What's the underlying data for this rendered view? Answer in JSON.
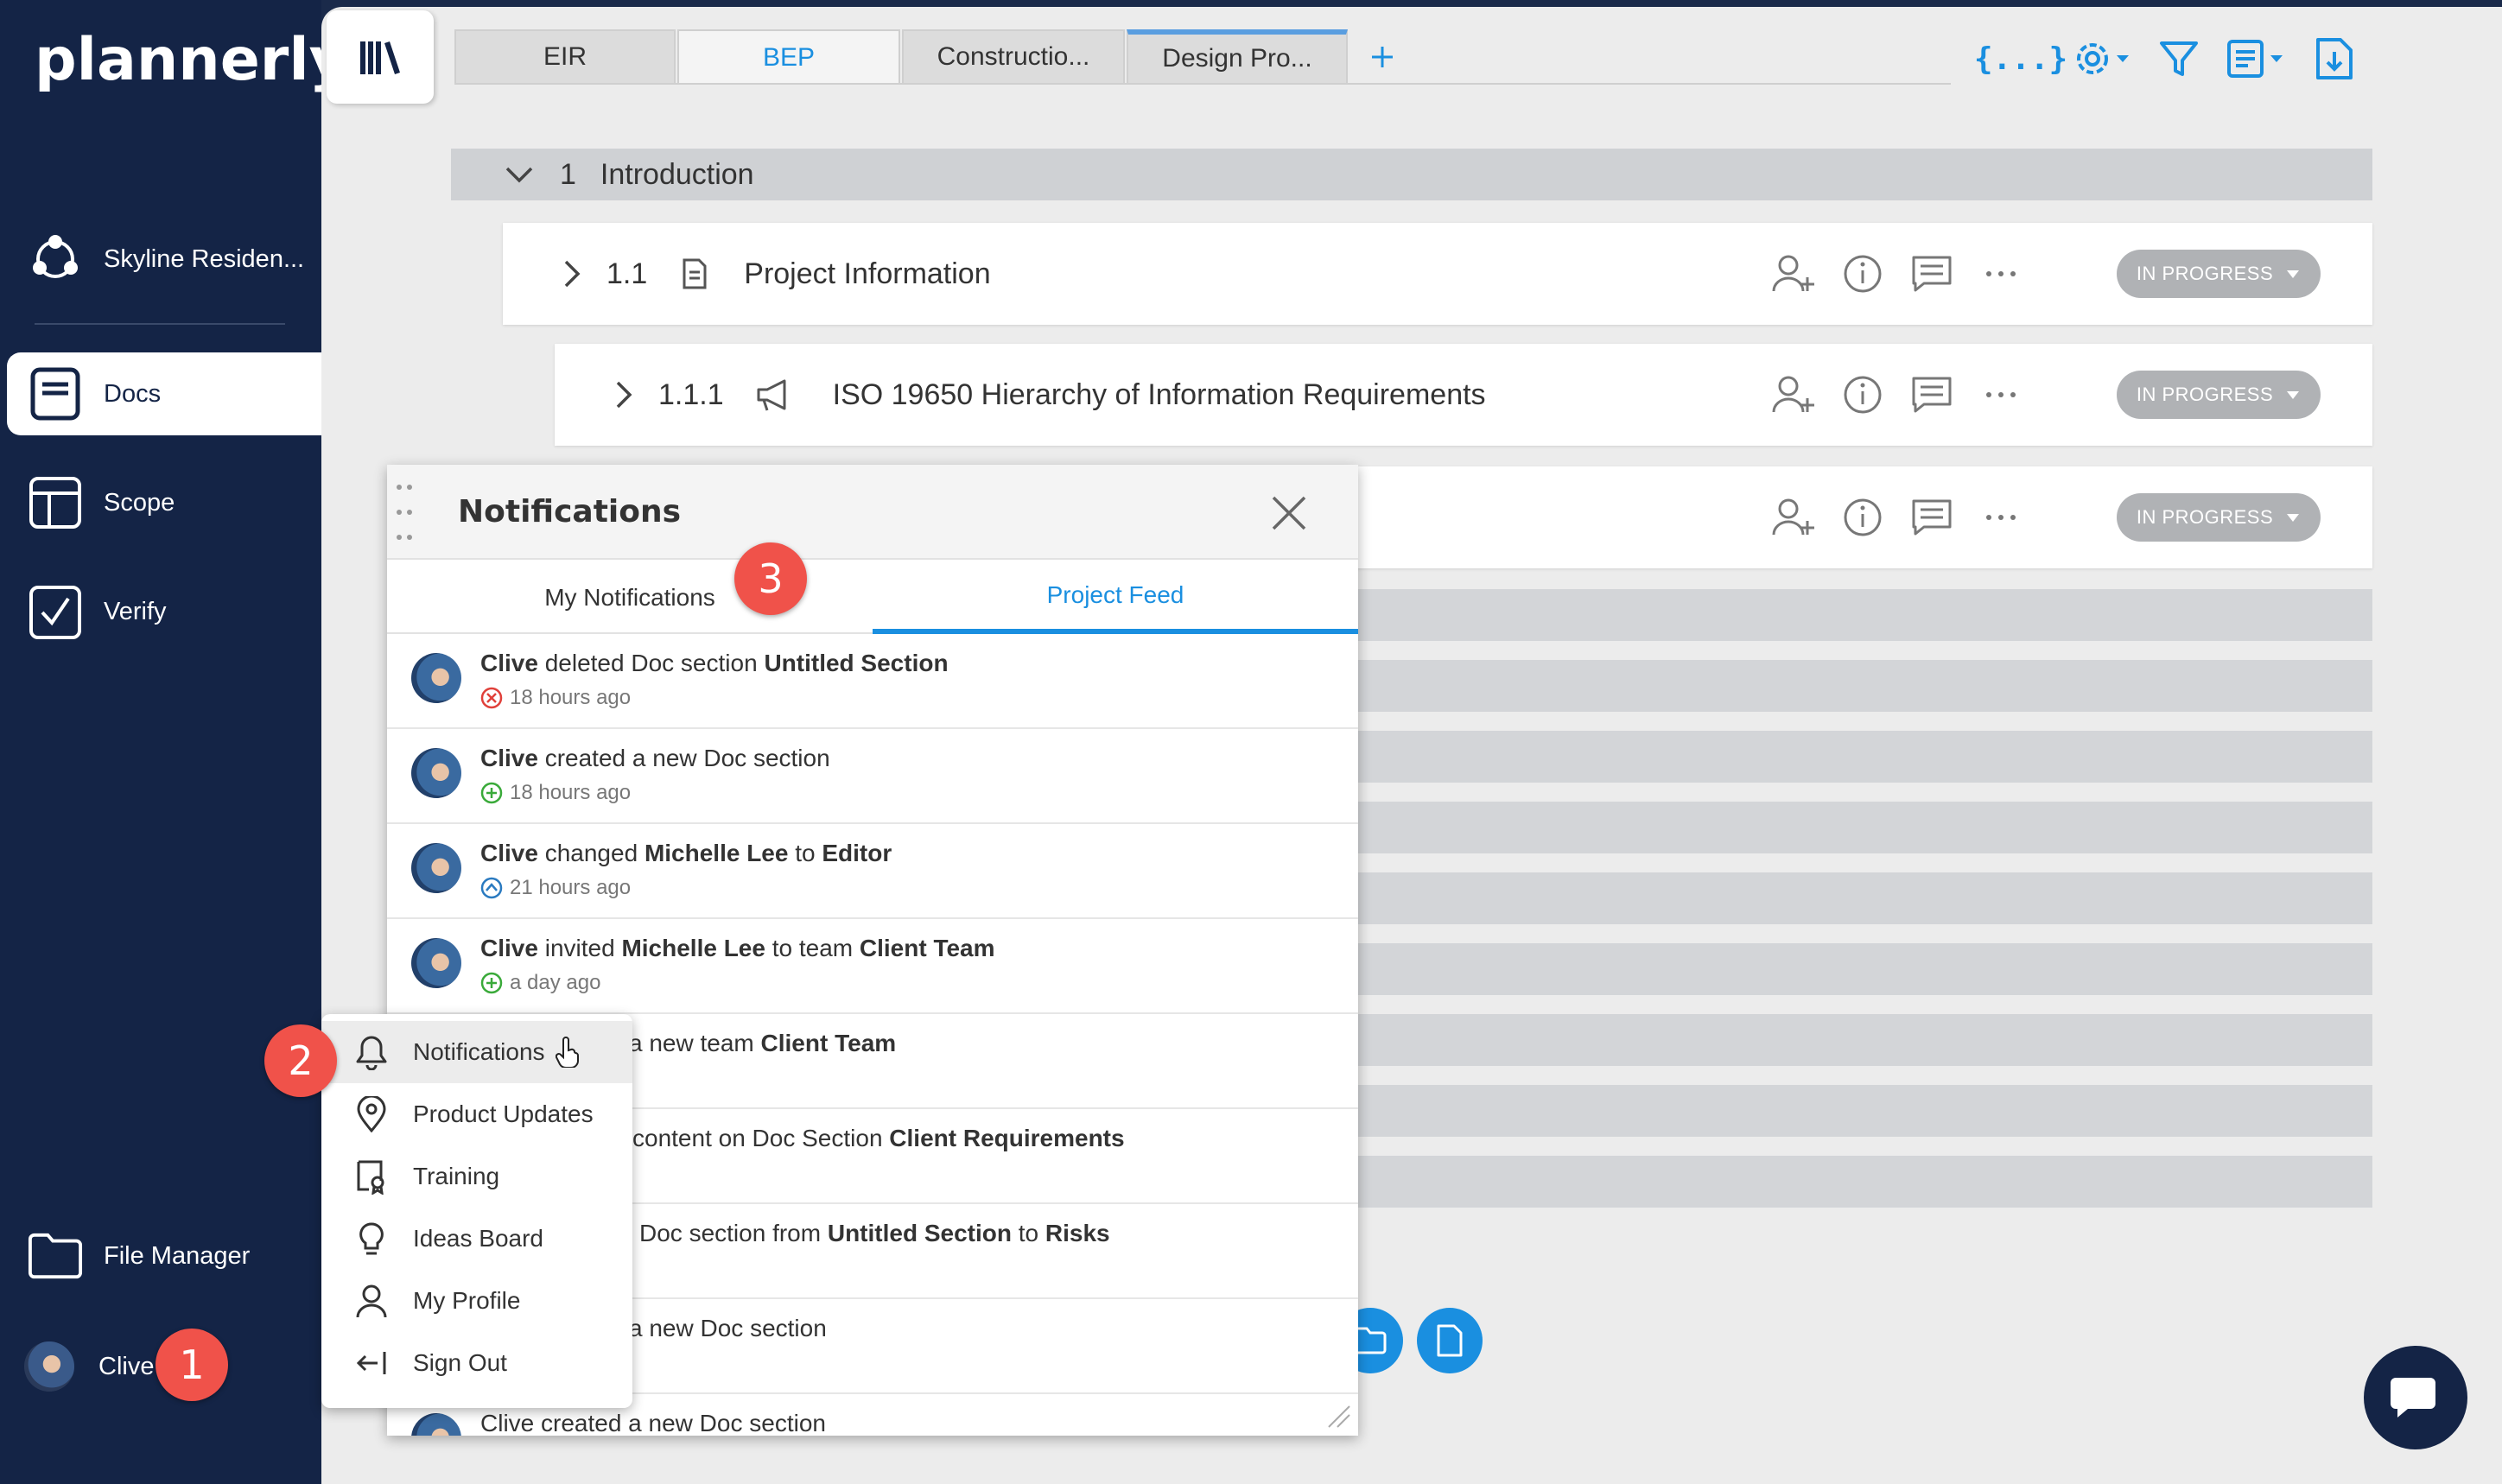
{
  "app": {
    "logo": "plannerly"
  },
  "sidebar": {
    "project": "Skyline Residen...",
    "items": [
      {
        "label": "Docs"
      },
      {
        "label": "Scope"
      },
      {
        "label": "Verify"
      }
    ],
    "file_manager": "File Manager",
    "user": "Clive"
  },
  "tabs": [
    {
      "label": "EIR"
    },
    {
      "label": "BEP"
    },
    {
      "label": "Constructio..."
    },
    {
      "label": "Design Pro..."
    }
  ],
  "toolbar": {
    "add_tab": "+",
    "variables": "{...}"
  },
  "sections": {
    "s1": {
      "number": "1",
      "title": "Introduction"
    },
    "s11": {
      "number": "1.1",
      "title": "Project Information",
      "status": "IN PROGRESS"
    },
    "s111": {
      "number": "1.1.1",
      "title": "ISO 19650 Hierarchy of Information Requirements",
      "status": "IN PROGRESS"
    },
    "s3": {
      "status": "IN PROGRESS"
    }
  },
  "notifications": {
    "title": "Notifications",
    "tabs": {
      "my": "My Notifications",
      "feed": "Project Feed"
    },
    "items": [
      {
        "p1": "Clive",
        "p2": " deleted Doc section ",
        "p3": "Untitled Section",
        "p4": "",
        "p5": "",
        "p6": "",
        "time": "18 hours ago",
        "kind": "delete"
      },
      {
        "p1": "Clive",
        "p2": " created a new Doc section",
        "p3": "",
        "p4": "",
        "p5": "",
        "p6": "",
        "time": "18 hours ago",
        "kind": "add"
      },
      {
        "p1": "Clive",
        "p2": " changed ",
        "p3": "Michelle Lee",
        "p4": " to ",
        "p5": "Editor",
        "p6": "",
        "time": "21 hours ago",
        "kind": "change"
      },
      {
        "p1": "Clive",
        "p2": " invited ",
        "p3": "Michelle Lee",
        "p4": " to team ",
        "p5": "Client Team",
        "p6": "",
        "time": "a day ago",
        "kind": "add"
      },
      {
        "p1": "",
        "p2": "a new team ",
        "p3": "Client Team",
        "p4": "",
        "p5": "",
        "p6": "",
        "time": "",
        "kind": ""
      },
      {
        "p1": "",
        "p2": "content on Doc Section ",
        "p3": "Client Requirements",
        "p4": "",
        "p5": "",
        "p6": "",
        "time": "",
        "kind": ""
      },
      {
        "p1": "",
        "p2": "Doc section from ",
        "p3": "Untitled Section",
        "p4": " to ",
        "p5": "Risks",
        "p6": "",
        "time": "",
        "kind": ""
      },
      {
        "p1": "",
        "p2": "a new Doc section",
        "p3": "",
        "p4": "",
        "p5": "",
        "p6": "",
        "time": "",
        "kind": ""
      },
      {
        "p1": "Clive",
        "p2": " created a new Doc section",
        "p3": "",
        "p4": "",
        "p5": "",
        "p6": "",
        "time": "",
        "kind": ""
      }
    ]
  },
  "user_menu": {
    "items": [
      {
        "label": "Notifications"
      },
      {
        "label": "Product Updates"
      },
      {
        "label": "Training"
      },
      {
        "label": "Ideas Board"
      },
      {
        "label": "My Profile"
      },
      {
        "label": "Sign Out"
      }
    ]
  },
  "badges": {
    "b1": "1",
    "b2": "2",
    "b3": "3"
  },
  "colors": {
    "navy": "#142446",
    "accent": "#1a8fe0",
    "badge": "#f0524a",
    "status": "#b0b2b5"
  }
}
